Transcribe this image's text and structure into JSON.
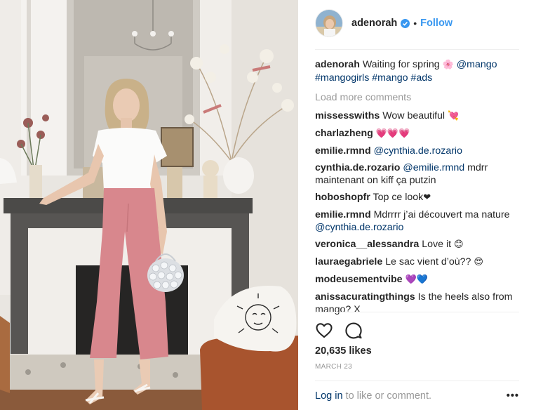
{
  "post": {
    "username": "adenorah",
    "follow_label": "Follow",
    "separator": "•",
    "caption_text": "Waiting for spring",
    "caption_emoji": "🌸",
    "caption_mention": "@mango",
    "caption_tags": "#mangogirls #mango #ads",
    "load_more": "Load more comments",
    "likes": "20,635 likes",
    "date": "MARCH 23"
  },
  "comments": [
    {
      "user": "missesswiths",
      "text": "Wow beautiful",
      "mention": "",
      "emoji": "💘"
    },
    {
      "user": "charlazheng",
      "text": "",
      "mention": "",
      "emoji": "💗💗💗"
    },
    {
      "user": "emilie.rmnd",
      "text": "",
      "mention": "@cynthia.de.rozario",
      "emoji": ""
    },
    {
      "user": "cynthia.de.rozario",
      "text": "mdrr maintenant on kiff ça putzin",
      "mention": "@emilie.rmnd",
      "emoji": ""
    },
    {
      "user": "hoboshopfr",
      "text": "Top ce look",
      "mention": "",
      "emoji": "❤"
    },
    {
      "user": "emilie.rmnd",
      "text": "Mdrrrr j’ai découvert ma nature",
      "mention": "@cynthia.de.rozario",
      "emoji": ""
    },
    {
      "user": "veronica__alessandra",
      "text": "Love it",
      "mention": "",
      "emoji": "😊"
    },
    {
      "user": "lauraegabriele",
      "text": "Le sac vient d’où??",
      "mention": "",
      "emoji": "😍"
    },
    {
      "user": "modeusementvibe",
      "text": "",
      "mention": "",
      "emoji": "💜💙"
    },
    {
      "user": "anissacuratingthings",
      "text": "Is the heels also from mango? X",
      "mention": "",
      "emoji": ""
    }
  ],
  "footer": {
    "login_link": "Log in",
    "login_rest": "to like or comment.",
    "more": "•••"
  },
  "icons": {
    "verified": "verified-badge-icon",
    "like": "heart-icon",
    "comment": "comment-bubble-icon"
  },
  "colors": {
    "accent": "#3897f0",
    "link": "#003569",
    "muted": "#999999",
    "text": "#262626"
  }
}
